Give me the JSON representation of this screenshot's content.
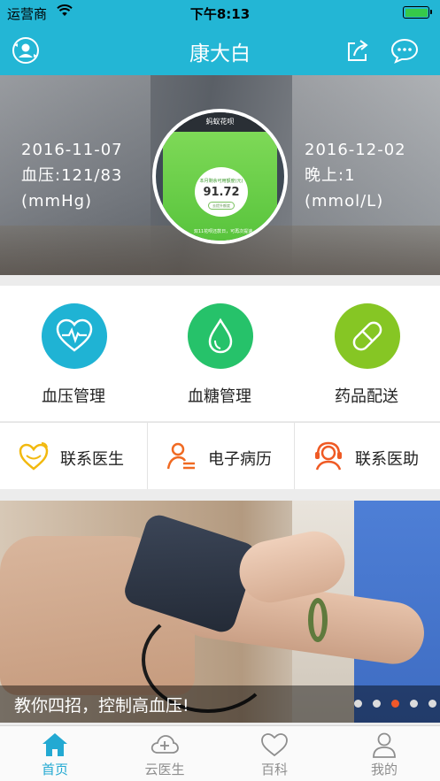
{
  "status_bar": {
    "carrier": "运营商",
    "time": "下午8:13"
  },
  "nav": {
    "title": "康大白"
  },
  "banner": {
    "left": {
      "date": "2016-11-07",
      "reading": "血压:121/83",
      "unit": "(mmHg)"
    },
    "right": {
      "date": "2016-12-02",
      "reading": "晚上:1",
      "unit": "(mmol/L)"
    },
    "ad": {
      "header": "蚂蚁花呗",
      "label": "本月剩余可用额度(元)",
      "value": "91.72",
      "button": "去提升额度",
      "footer": "双11花呗还款日，可再次提速"
    }
  },
  "main_features": [
    {
      "label": "血压管理",
      "color": "#1fb3d4"
    },
    {
      "label": "血糖管理",
      "color": "#26c26a"
    },
    {
      "label": "药品配送",
      "color": "#86c624"
    }
  ],
  "contacts": [
    {
      "label": "联系医生",
      "color": "#f2b90f"
    },
    {
      "label": "电子病历",
      "color": "#f06a22"
    },
    {
      "label": "联系医助",
      "color": "#ef5a24"
    }
  ],
  "article": {
    "caption": "教你四招，控制高血压!",
    "active_dot": 3,
    "dot_count": 5
  },
  "tabs": [
    {
      "label": "首页",
      "icon": "home-icon",
      "active": true
    },
    {
      "label": "云医生",
      "icon": "cloud-doctor-icon",
      "active": false
    },
    {
      "label": "百科",
      "icon": "heart-icon",
      "active": false
    },
    {
      "label": "我的",
      "icon": "user-icon",
      "active": false
    }
  ],
  "colors": {
    "primary": "#23b6d5",
    "tab_active": "#23a9d2",
    "dot_active": "#f0582a"
  }
}
